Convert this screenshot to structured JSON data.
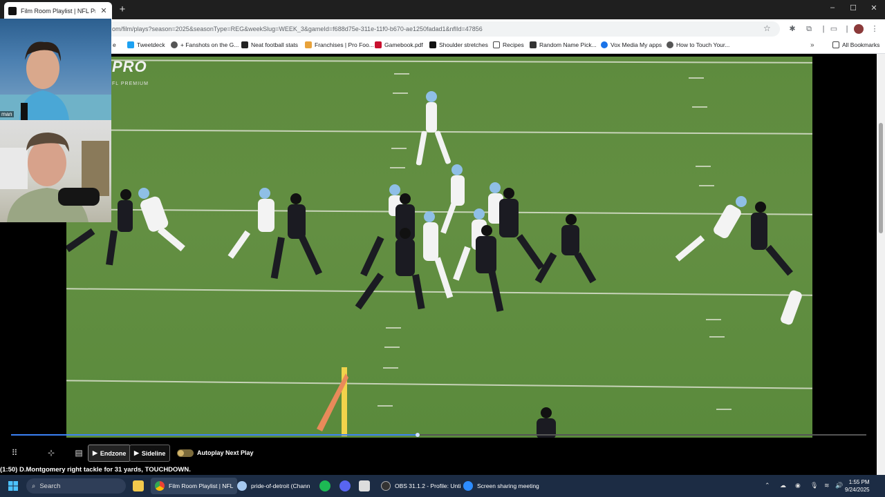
{
  "browser": {
    "tab_title": "Film Room Playlist | NFL Pro",
    "new_tab_label": "+",
    "url": "om/film/plays?season=2025&seasonType=REG&weekSlug=WEEK_3&gameId=f688d75e-311e-11f0-b670-ae1250fadad1&nflId=47856",
    "window_controls": [
      "–",
      "☐",
      "✕"
    ]
  },
  "bookmarks": {
    "items": [
      {
        "label": "e",
        "icon": "bookmark-icon"
      },
      {
        "label": "Tweetdeck",
        "icon": "twitter-icon"
      },
      {
        "label": "+ Fanshots on the G...",
        "icon": "globe-icon"
      },
      {
        "label": "Neat football stats",
        "icon": "nfl-icon"
      },
      {
        "label": "Franchises | Pro Foo...",
        "icon": "pfr-icon"
      },
      {
        "label": "Gamebook.pdf",
        "icon": "nfl-icon"
      },
      {
        "label": "Shoulder stretches",
        "icon": "s-icon"
      },
      {
        "label": "Recipes",
        "icon": "folder-icon"
      },
      {
        "label": "Random Name Pick...",
        "icon": "list-icon"
      },
      {
        "label": "Vox Media My apps",
        "icon": "okta-icon"
      },
      {
        "label": "How to Touch Your...",
        "icon": "globe-icon"
      }
    ],
    "more_label": "»",
    "all_label": "All Bookmarks"
  },
  "video": {
    "brand": "PRO",
    "brand_sub": "FL PREMIUM",
    "progress_fraction": 0.475
  },
  "webcams": {
    "top_label": "man"
  },
  "controls": {
    "endzone_label": "Endzone",
    "sideline_label": "Sideline",
    "autoplay_label": "Autoplay Next Play",
    "autoplay_on": true,
    "play_description": "(1:50) D.Montgomery right tackle for 31 yards, TOUCHDOWN."
  },
  "taskbar": {
    "search_placeholder": "Search",
    "apps": [
      {
        "label": "Film Room Playlist | NFL",
        "icon": "chrome-icon"
      },
      {
        "label": "pride-of-detroit (Chann",
        "icon": "chrome-profile-icon"
      },
      {
        "label": "OBS 31.1.2 - Profile: Unti",
        "icon": "obs-icon"
      },
      {
        "label": "Screen sharing meeting",
        "icon": "zoom-icon"
      }
    ],
    "time": "1:55 PM",
    "date": "9/24/2025"
  },
  "colors": {
    "field": "#5e8b3e",
    "accent": "#3b82f6",
    "taskbar": "#1c2c44"
  }
}
